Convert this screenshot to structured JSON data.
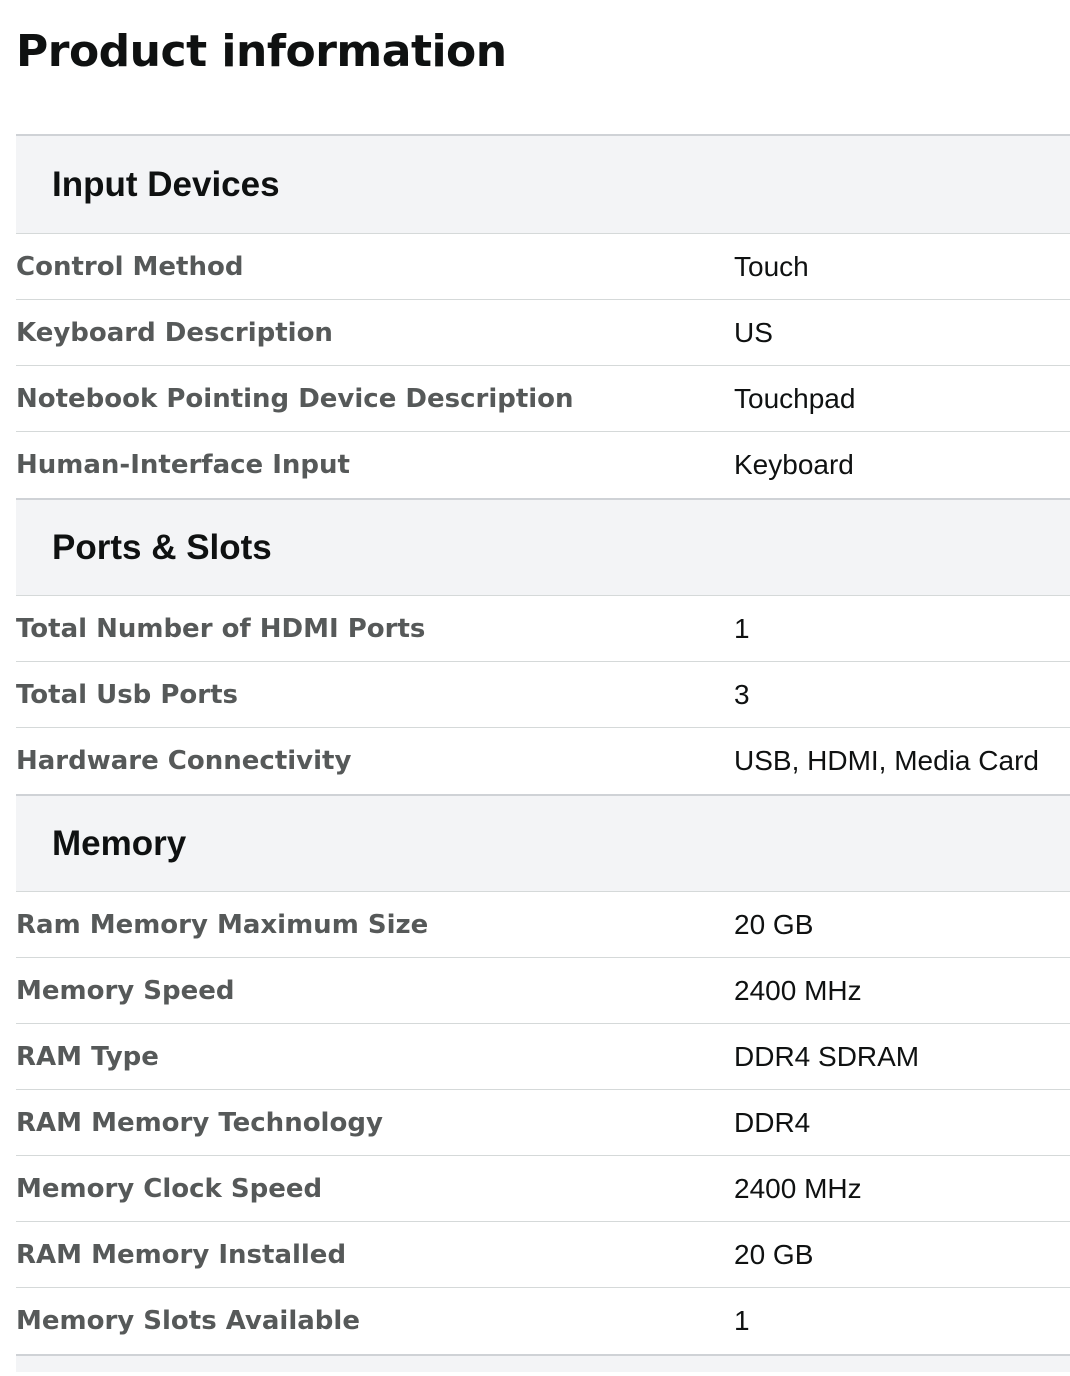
{
  "page": {
    "title": "Product information"
  },
  "sections": [
    {
      "title": "Input Devices",
      "rows": [
        {
          "key": "Control Method",
          "value": "Touch"
        },
        {
          "key": "Keyboard Description",
          "value": "US"
        },
        {
          "key": "Notebook Pointing Device Description",
          "value": "Touchpad"
        },
        {
          "key": "Human-Interface Input",
          "value": "Keyboard"
        }
      ]
    },
    {
      "title": "Ports & Slots",
      "rows": [
        {
          "key": "Total Number of HDMI Ports",
          "value": "1"
        },
        {
          "key": "Total Usb Ports",
          "value": "3"
        },
        {
          "key": "Hardware Connectivity",
          "value": "USB, HDMI, Media Card"
        }
      ]
    },
    {
      "title": "Memory",
      "rows": [
        {
          "key": "Ram Memory Maximum Size",
          "value": "20 GB"
        },
        {
          "key": "Memory Speed",
          "value": "2400 MHz"
        },
        {
          "key": "RAM Type",
          "value": "DDR4 SDRAM"
        },
        {
          "key": "RAM Memory Technology",
          "value": "DDR4"
        },
        {
          "key": "Memory Clock Speed",
          "value": "2400 MHz"
        },
        {
          "key": "RAM Memory Installed",
          "value": "20 GB"
        },
        {
          "key": "Memory Slots Available",
          "value": "1"
        }
      ]
    }
  ],
  "colors": {
    "header_background": "#f3f4f6",
    "key_text": "#565959",
    "value_text": "#0f1111",
    "divider": "#d5d9d9"
  }
}
